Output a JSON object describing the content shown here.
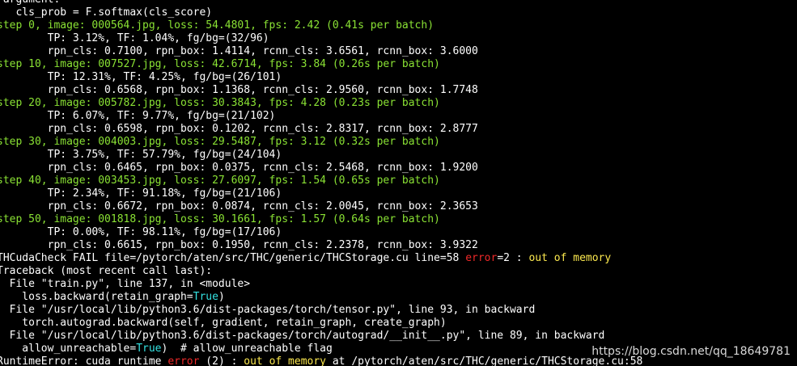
{
  "terminal": {
    "lines": [
      [
        {
          "t": " argument.",
          "c": "white"
        }
      ],
      [
        {
          "t": "   cls_prob = F.softmax(cls_score)",
          "c": "white"
        }
      ],
      [
        {
          "t": "step 0, image: 000564.jpg, loss: 54.4801, fps: 2.42 (0.41s per batch)",
          "c": "green"
        }
      ],
      [
        {
          "t": "        TP: 3.12%, TF: 1.04%, fg/bg=(32/96)",
          "c": "white"
        }
      ],
      [
        {
          "t": "        rpn_cls: 0.7100, rpn_box: 1.4114, rcnn_cls: 3.6561, rcnn_box: 3.6000",
          "c": "white"
        }
      ],
      [
        {
          "t": "step 10, image: 007527.jpg, loss: 42.6714, fps: 3.84 (0.26s per batch)",
          "c": "green"
        }
      ],
      [
        {
          "t": "        TP: 12.31%, TF: 4.25%, fg/bg=(26/101)",
          "c": "white"
        }
      ],
      [
        {
          "t": "        rpn_cls: 0.6568, rpn_box: 1.1368, rcnn_cls: 2.9560, rcnn_box: 1.7748",
          "c": "white"
        }
      ],
      [
        {
          "t": "step 20, image: 005782.jpg, loss: 30.3843, fps: 4.28 (0.23s per batch)",
          "c": "green"
        }
      ],
      [
        {
          "t": "        TP: 6.07%, TF: 9.77%, fg/bg=(21/102)",
          "c": "white"
        }
      ],
      [
        {
          "t": "        rpn_cls: 0.6598, rpn_box: 0.1202, rcnn_cls: 2.8317, rcnn_box: 2.8777",
          "c": "white"
        }
      ],
      [
        {
          "t": "step 30, image: 004003.jpg, loss: 29.5487, fps: 3.12 (0.32s per batch)",
          "c": "green"
        }
      ],
      [
        {
          "t": "        TP: 3.75%, TF: 57.79%, fg/bg=(24/104)",
          "c": "white"
        }
      ],
      [
        {
          "t": "        rpn_cls: 0.6465, rpn_box: 0.0375, rcnn_cls: 2.5468, rcnn_box: 1.9200",
          "c": "white"
        }
      ],
      [
        {
          "t": "step 40, image: 003453.jpg, loss: 27.6097, fps: 1.54 (0.65s per batch)",
          "c": "green"
        }
      ],
      [
        {
          "t": "        TP: 2.34%, TF: 91.18%, fg/bg=(21/106)",
          "c": "white"
        }
      ],
      [
        {
          "t": "        rpn_cls: 0.6672, rpn_box: 0.0874, rcnn_cls: 2.0045, rcnn_box: 2.3653",
          "c": "white"
        }
      ],
      [
        {
          "t": "step 50, image: 001818.jpg, loss: 30.1661, fps: 1.57 (0.64s per batch)",
          "c": "green"
        }
      ],
      [
        {
          "t": "        TP: 0.00%, TF: 98.11%, fg/bg=(17/106)",
          "c": "white"
        }
      ],
      [
        {
          "t": "        rpn_cls: 0.6615, rpn_box: 0.1950, rcnn_cls: 2.2378, rcnn_box: 3.9322",
          "c": "white"
        }
      ],
      [
        {
          "t": "THCudaCheck FAIL file=/pytorch/aten/src/THC/generic/THCStorage.cu line=58 ",
          "c": "white"
        },
        {
          "t": "error",
          "c": "red"
        },
        {
          "t": "=2 : ",
          "c": "white"
        },
        {
          "t": "out of memory",
          "c": "yellow"
        }
      ],
      [
        {
          "t": "Traceback (most recent call last):",
          "c": "white"
        }
      ],
      [
        {
          "t": "  File \"train.py\", line 137, in <module>",
          "c": "white"
        }
      ],
      [
        {
          "t": "    loss.backward(retain_graph=",
          "c": "white"
        },
        {
          "t": "True",
          "c": "cyan"
        },
        {
          "t": ")",
          "c": "white"
        }
      ],
      [
        {
          "t": "  File \"/usr/local/lib/python3.6/dist-packages/torch/tensor.py\", line 93, in backward",
          "c": "white"
        }
      ],
      [
        {
          "t": "    torch.autograd.backward(self, gradient, retain_graph, create_graph)",
          "c": "white"
        }
      ],
      [
        {
          "t": "  File \"/usr/local/lib/python3.6/dist-packages/torch/autograd/__init__.py\", line 89, in backward",
          "c": "white"
        }
      ],
      [
        {
          "t": "    allow_unreachable=",
          "c": "white"
        },
        {
          "t": "True",
          "c": "cyan"
        },
        {
          "t": ")  # allow_unreachable flag",
          "c": "white"
        }
      ],
      [
        {
          "t": "RuntimeError: cuda runtime ",
          "c": "white"
        },
        {
          "t": "error",
          "c": "red"
        },
        {
          "t": " (2) : ",
          "c": "white"
        },
        {
          "t": "out of memory",
          "c": "yellow"
        },
        {
          "t": " at /pytorch/aten/src/THC/generic/THCStorage.cu:58",
          "c": "white"
        }
      ]
    ]
  },
  "watermark": {
    "text": "https://blog.csdn.net/qq_18649781"
  },
  "colors": {
    "background": "#000000",
    "text": "#ffffff",
    "green": "#8ae234",
    "red": "#ef2929",
    "yellow": "#fce94f",
    "cyan": "#34e2e2"
  }
}
